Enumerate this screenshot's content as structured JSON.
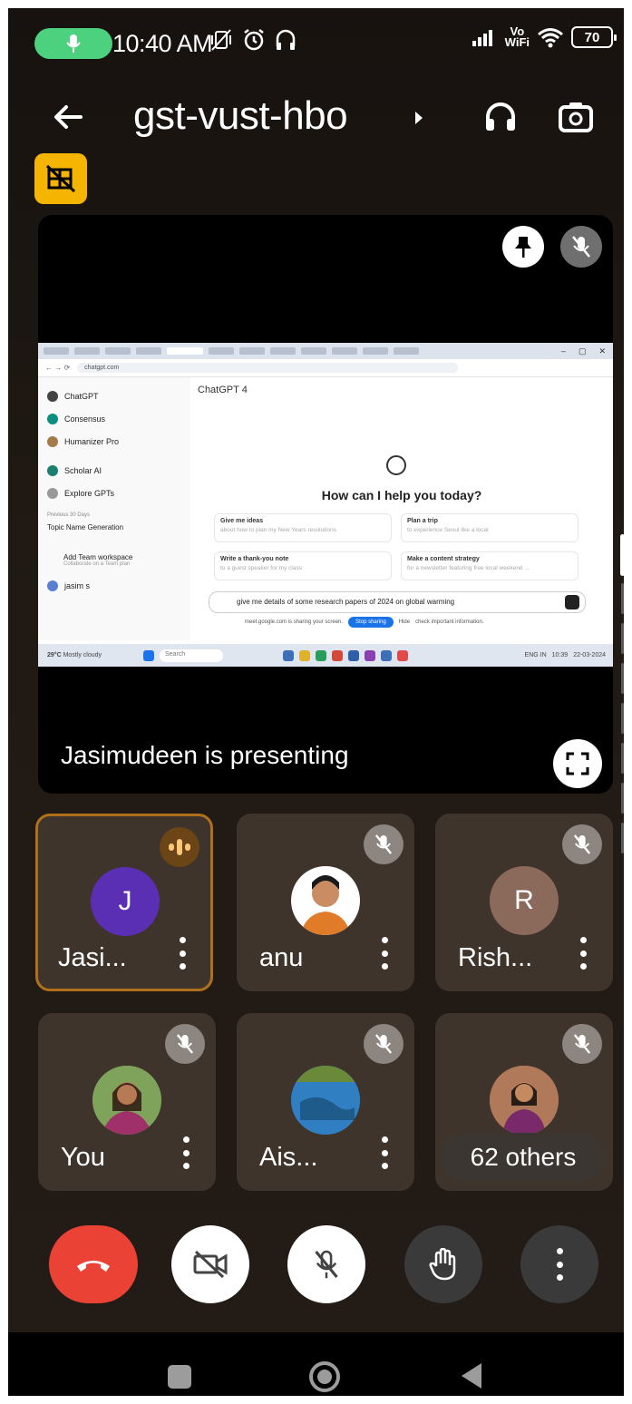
{
  "status_bar": {
    "time": "10:40 AM",
    "volte_top": "Vo",
    "volte_bottom": "WiFi",
    "battery": "70"
  },
  "header": {
    "title": "gst-vust-hbo"
  },
  "presentation": {
    "label": "Jasimudeen is presenting",
    "screen": {
      "url": "chatgpt.com",
      "model": "ChatGPT 4",
      "sidebar": [
        "ChatGPT",
        "Consensus",
        "Humanizer Pro",
        "Scholar AI",
        "Explore GPTs"
      ],
      "sidebar_section": "Previous 30 Days",
      "history_item": "Topic Name Generation",
      "workspace": "Add Team workspace",
      "workspace_sub": "Collaborate on a Team plan",
      "user": "jasim s",
      "heading": "How can I help you today?",
      "suggestions": [
        {
          "title": "Give me ideas",
          "sub": "about how to plan my New Years resolutions"
        },
        {
          "title": "Plan a trip",
          "sub": "to experience Seoul like a local"
        },
        {
          "title": "Write a thank-you note",
          "sub": "to a guest speaker for my class"
        },
        {
          "title": "Make a content strategy",
          "sub": "for a newsletter featuring free local weekend ..."
        }
      ],
      "input": "give me details of some research papers of 2024 on global warming",
      "share_notice": "meet.google.com is sharing your screen.",
      "stop_sharing": "Stop sharing",
      "hide": "Hide",
      "check_info": "check important information.",
      "taskbar_weather": "29°C",
      "taskbar_weather_sub": "Mostly cloudy",
      "taskbar_search": "Search",
      "taskbar_lang": "ENG IN",
      "taskbar_time": "10:39",
      "taskbar_date": "22-03-2024"
    }
  },
  "participants": [
    {
      "name": "Jasi...",
      "initial": "J",
      "avatar_color": "#5b2fb3",
      "speaking": true
    },
    {
      "name": "anu",
      "initial": "",
      "avatar_color": "#c98c63",
      "muted": true
    },
    {
      "name": "Rish...",
      "initial": "R",
      "avatar_color": "#8b6a5c",
      "muted": true
    },
    {
      "name": "You",
      "initial": "",
      "avatar_color": "#6b8f4a",
      "muted": true
    },
    {
      "name": "Ais...",
      "initial": "",
      "avatar_color": "#2f7fc2",
      "muted": true
    },
    {
      "name": "",
      "initial": "",
      "avatar_color": "#b07a5a",
      "muted": true
    }
  ],
  "others_count": "62 others",
  "controls": {
    "end_call": "end-call",
    "camera": "camera-off",
    "mic": "mic-off",
    "hand": "raise-hand",
    "more": "more-options"
  },
  "colors": {
    "accent_speaking": "#b0701b",
    "end_call": "#ea4335",
    "badge": "#f5b400"
  }
}
